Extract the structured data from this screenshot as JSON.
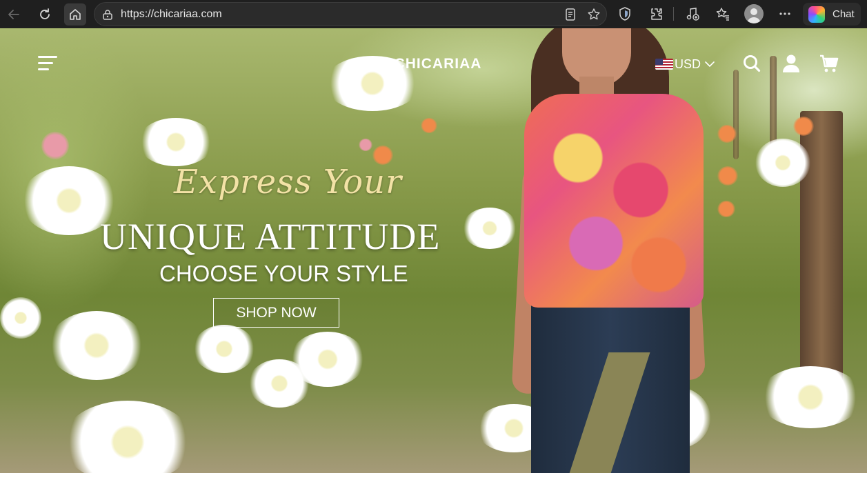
{
  "browser": {
    "url": "https://chicariaa.com",
    "chat_label": "Chat"
  },
  "header": {
    "brand": "CHICARIAA",
    "currency": "USD"
  },
  "hero": {
    "script_title": "Express Your",
    "main_title": "UNIQUE ATTITUDE",
    "subtitle": "CHOOSE YOUR STYLE",
    "cta_label": "SHOP NOW"
  },
  "icons": {
    "browser": [
      "back-icon",
      "refresh-icon",
      "home-icon",
      "lock-icon",
      "reader-view-icon",
      "favorite-star-icon",
      "shield-icon",
      "extensions-icon",
      "media-control-icon",
      "favorites-list-icon",
      "profile-avatar",
      "more-options-icon",
      "copilot-icon"
    ],
    "site": [
      "hamburger-menu-icon",
      "us-flag-icon",
      "chevron-down-icon",
      "search-icon",
      "account-icon",
      "cart-icon"
    ]
  },
  "colors": {
    "browser_bar": "#1f1f1f",
    "script_title": "#f3e2a6",
    "text_white": "#ffffff"
  }
}
